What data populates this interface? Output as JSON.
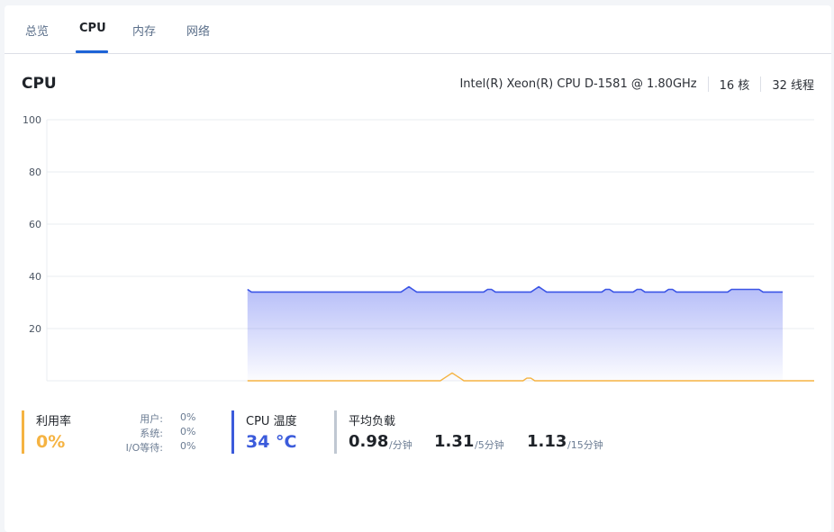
{
  "tabs": [
    {
      "label": "总览"
    },
    {
      "label": "CPU"
    },
    {
      "label": "内存"
    },
    {
      "label": "网络"
    }
  ],
  "section": {
    "title": "CPU"
  },
  "cpu_info": {
    "model": "Intel(R) Xeon(R) CPU D-1581 @ 1.80GHz",
    "cores": "16 核",
    "threads": "32 线程"
  },
  "colors": {
    "accent": "#1e63d6",
    "usage": "#f5b342",
    "temperature": "#3b5bdb",
    "load": "#c0c8d2",
    "load_line": "#3b55e6",
    "usage_line": "#f5b342"
  },
  "chart_data": {
    "type": "area",
    "ylim": [
      0,
      100
    ],
    "yticks": [
      "100",
      "80",
      "60",
      "40",
      "20"
    ],
    "grid": true,
    "x": [
      0,
      1,
      2,
      3,
      4,
      5,
      6,
      7,
      8,
      9,
      10,
      11,
      12,
      13,
      14,
      15,
      16,
      17,
      18,
      19,
      20,
      21,
      22,
      23,
      24,
      25,
      26,
      27,
      28,
      29,
      30,
      31,
      32,
      33,
      34,
      35,
      36,
      37,
      38,
      39,
      40,
      41,
      42,
      43,
      44,
      45,
      46,
      47,
      48,
      49,
      50,
      51,
      52,
      53,
      54,
      55,
      56,
      57,
      58,
      59,
      60,
      61,
      62,
      63,
      64,
      65,
      66,
      67,
      68,
      69,
      70,
      71,
      72,
      73,
      74,
      75,
      76,
      77,
      78,
      79,
      80,
      81,
      82,
      83,
      84,
      85,
      86,
      87,
      88,
      89,
      90,
      91,
      92,
      93,
      94,
      95,
      96,
      97,
      98,
      99,
      100,
      101,
      102,
      103,
      104,
      105,
      106,
      107,
      108,
      109,
      110,
      111,
      112,
      113,
      114,
      115,
      116,
      117,
      118,
      119,
      120,
      121,
      122,
      123,
      124,
      125,
      126,
      127,
      128,
      129,
      130,
      131,
      132,
      133,
      134,
      135,
      136,
      137,
      138,
      139,
      140,
      141,
      142,
      143,
      144,
      145,
      146,
      147,
      148,
      149,
      150,
      151,
      152,
      153,
      154,
      155,
      156,
      157,
      158,
      159,
      160,
      161,
      162,
      163,
      164,
      165,
      166,
      167,
      168,
      169,
      170,
      171,
      172,
      173,
      174,
      175,
      176,
      177,
      178,
      179,
      180,
      181,
      182,
      183,
      184,
      185,
      186,
      187,
      188,
      189,
      190,
      191,
      192,
      193,
      194,
      195
    ],
    "series": [
      {
        "key": "load",
        "start": 51,
        "values": [
          35,
          34,
          34,
          34,
          34,
          34,
          34,
          34,
          34,
          34,
          34,
          34,
          34,
          34,
          34,
          34,
          34,
          34,
          34,
          34,
          34,
          34,
          34,
          34,
          34,
          34,
          34,
          34,
          34,
          34,
          34,
          34,
          34,
          34,
          34,
          34,
          34,
          34,
          34,
          34,
          35,
          36,
          35,
          34,
          34,
          34,
          34,
          34,
          34,
          34,
          34,
          34,
          34,
          34,
          34,
          34,
          34,
          34,
          34,
          34,
          34,
          35,
          35,
          34,
          34,
          34,
          34,
          34,
          34,
          34,
          34,
          34,
          34,
          35,
          36,
          35,
          34,
          34,
          34,
          34,
          34,
          34,
          34,
          34,
          34,
          34,
          34,
          34,
          34,
          34,
          34,
          35,
          35,
          34,
          34,
          34,
          34,
          34,
          34,
          35,
          35,
          34,
          34,
          34,
          34,
          34,
          34,
          35,
          35,
          34,
          34,
          34,
          34,
          34,
          34,
          34,
          34,
          34,
          34,
          34,
          34,
          34,
          34,
          35,
          35,
          35,
          35,
          35,
          35,
          35,
          35,
          34,
          34,
          34,
          34,
          34,
          34
        ]
      },
      {
        "key": "usage",
        "start": 51,
        "values": [
          0,
          0,
          0,
          0,
          0,
          0,
          0,
          0,
          0,
          0,
          0,
          0,
          0,
          0,
          0,
          0,
          0,
          0,
          0,
          0,
          0,
          0,
          0,
          0,
          0,
          0,
          0,
          0,
          0,
          0,
          0,
          0,
          0,
          0,
          0,
          0,
          0,
          0,
          0,
          0,
          0,
          0,
          0,
          0,
          0,
          0,
          0,
          0,
          0,
          0,
          1,
          2,
          3,
          2,
          1,
          0,
          0,
          0,
          0,
          0,
          0,
          0,
          0,
          0,
          0,
          0,
          0,
          0,
          0,
          0,
          0,
          1,
          1,
          0,
          0,
          0,
          0,
          0,
          0,
          0,
          0,
          0,
          0,
          0,
          0,
          0,
          0,
          0,
          0,
          0,
          0,
          0,
          0,
          0,
          0,
          0,
          0,
          0,
          0,
          0,
          0,
          0,
          0,
          0,
          0,
          0,
          0,
          0,
          0,
          0,
          0,
          0,
          0,
          0,
          0,
          0,
          0,
          0,
          0,
          0,
          0,
          0,
          0,
          0,
          0,
          0,
          0,
          0,
          0,
          0,
          0,
          0,
          0,
          0,
          0,
          0,
          0,
          0,
          0,
          0,
          0,
          0,
          0,
          0,
          0
        ]
      }
    ]
  },
  "stats": {
    "usage": {
      "label": "利用率",
      "value": "0%",
      "user_key": "用户:",
      "user_val": "0%",
      "sys_key": "系统:",
      "sys_val": "0%",
      "io_key": "I/O等待:",
      "io_val": "0%"
    },
    "temperature": {
      "label": "CPU 温度",
      "value": "34 °C"
    },
    "load": {
      "label": "平均负载",
      "one": "0.98",
      "one_unit": "/分钟",
      "five": "1.31",
      "five_unit": "/5分钟",
      "fifteen": "1.13",
      "fifteen_unit": "/15分钟"
    }
  }
}
